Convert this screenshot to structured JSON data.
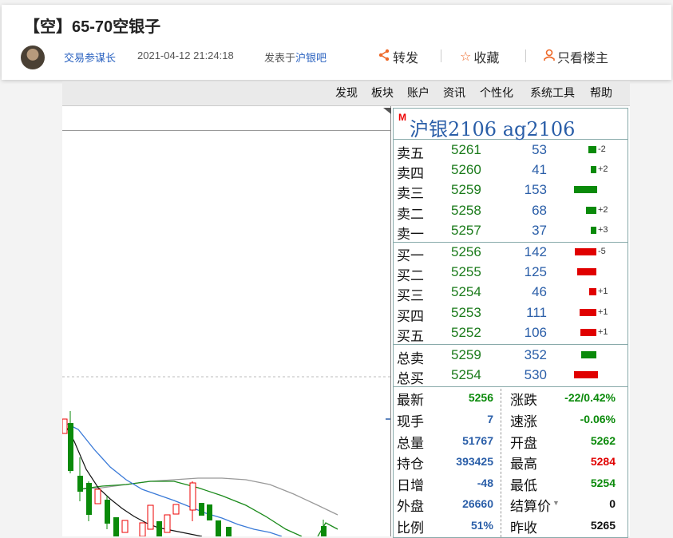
{
  "post": {
    "title": "【空】65-70空银子",
    "author": "交易参谋长",
    "time": "2021-04-12 21:24:18",
    "from_prefix": "发表于",
    "from_link": "沪银吧",
    "actions": {
      "share": "转发",
      "collect": "收藏",
      "only_op": "只看楼主"
    }
  },
  "terminal": {
    "menu": [
      "发现",
      "板块",
      "账户",
      "资讯",
      "个性化",
      "系统工具",
      "帮助"
    ],
    "quote_title": "沪银2106  ag2106",
    "badge": "M",
    "asks": [
      {
        "label": "卖五",
        "price": "5261",
        "vol": "53",
        "bar": 0.16,
        "chg": "-2"
      },
      {
        "label": "卖四",
        "price": "5260",
        "vol": "41",
        "bar": 0.12,
        "chg": "+2"
      },
      {
        "label": "卖三",
        "price": "5259",
        "vol": "153",
        "bar": 0.47,
        "chg": ""
      },
      {
        "label": "卖二",
        "price": "5258",
        "vol": "68",
        "bar": 0.21,
        "chg": "+2"
      },
      {
        "label": "卖一",
        "price": "5257",
        "vol": "37",
        "bar": 0.11,
        "chg": "+3"
      }
    ],
    "bids": [
      {
        "label": "买一",
        "price": "5256",
        "vol": "142",
        "bar": 0.43,
        "chg": "-5"
      },
      {
        "label": "买二",
        "price": "5255",
        "vol": "125",
        "bar": 0.38,
        "chg": ""
      },
      {
        "label": "买三",
        "price": "5254",
        "vol": "46",
        "bar": 0.14,
        "chg": "+1"
      },
      {
        "label": "买四",
        "price": "5253",
        "vol": "111",
        "bar": 0.34,
        "chg": "+1"
      },
      {
        "label": "买五",
        "price": "5252",
        "vol": "106",
        "bar": 0.32,
        "chg": "+1"
      }
    ],
    "totals": [
      {
        "label": "总卖",
        "price": "5259",
        "vol": "352",
        "bar": 0.3,
        "color": "#0a8a0a"
      },
      {
        "label": "总买",
        "price": "5254",
        "vol": "530",
        "bar": 0.48,
        "color": "#e00000"
      }
    ],
    "stats": [
      {
        "l1": "最新",
        "v1": "5256",
        "c1": "#0a8a0a",
        "l2": "涨跌",
        "v2": "-22/0.42%",
        "c2": "#0a8a0a"
      },
      {
        "l1": "现手",
        "v1": "7",
        "c1": "#2a5ea8",
        "l2": "速涨",
        "v2": "-0.06%",
        "c2": "#0a8a0a"
      },
      {
        "l1": "总量",
        "v1": "51767",
        "c1": "#2a5ea8",
        "l2": "开盘",
        "v2": "5262",
        "c2": "#0a8a0a"
      },
      {
        "l1": "持仓",
        "v1": "393425",
        "c1": "#2a5ea8",
        "l2": "最高",
        "v2": "5284",
        "c2": "#e00000"
      },
      {
        "l1": "日增",
        "v1": "-48",
        "c1": "#2a5ea8",
        "l2": "最低",
        "v2": "5254",
        "c2": "#0a8a0a"
      },
      {
        "l1": "外盘",
        "v1": "26660",
        "c1": "#2a5ea8",
        "l2": "结算价",
        "v2": "0",
        "c2": "#111111"
      },
      {
        "l1": "比例",
        "v1": "51%",
        "c1": "#2a5ea8",
        "l2": "昨收",
        "v2": "5265",
        "c2": "#111111"
      }
    ]
  }
}
